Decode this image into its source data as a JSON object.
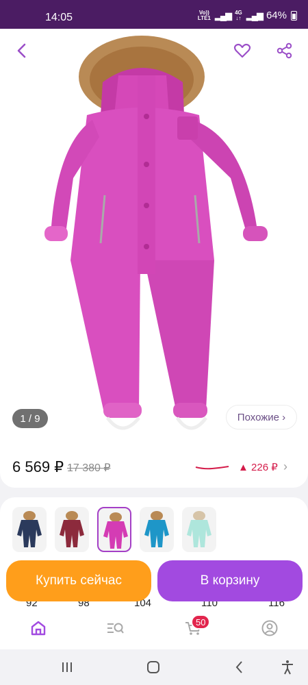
{
  "status_bar": {
    "time": "14:05",
    "volte_top": "Vo))",
    "volte_bottom": "LTE1",
    "net_top": "4G",
    "net_bottom": "↓↑",
    "battery": "64%"
  },
  "product": {
    "image_counter": "1 / 9",
    "similar_label": "Похожие ›",
    "price_current": "6 569 ₽",
    "price_old": "17 380 ₽",
    "price_change": "▲ 226 ₽",
    "price_chevron": "›"
  },
  "variants": {
    "colors": [
      {
        "name": "navy",
        "hex": "#2b3a5c"
      },
      {
        "name": "burgundy",
        "hex": "#8c2a3c"
      },
      {
        "name": "magenta",
        "hex": "#d43cb4",
        "selected": true
      },
      {
        "name": "blue",
        "hex": "#1e96c8"
      },
      {
        "name": "mint",
        "hex": "#aee6dc"
      }
    ],
    "sizes": [
      "92",
      "98",
      "104",
      "110",
      "116"
    ]
  },
  "actions": {
    "buy_now": "Купить сейчас",
    "to_cart": "В корзину"
  },
  "bottom_nav": {
    "items": [
      "home-icon",
      "catalog-search-icon",
      "cart-icon",
      "profile-icon"
    ],
    "cart_count": "50"
  },
  "colors": {
    "brand_purple": "#a24ae0",
    "status_bar": "#4b1c63",
    "buy_orange": "#ff9e1b",
    "price_red": "#d41c4a",
    "badge_red": "#e2254d"
  }
}
